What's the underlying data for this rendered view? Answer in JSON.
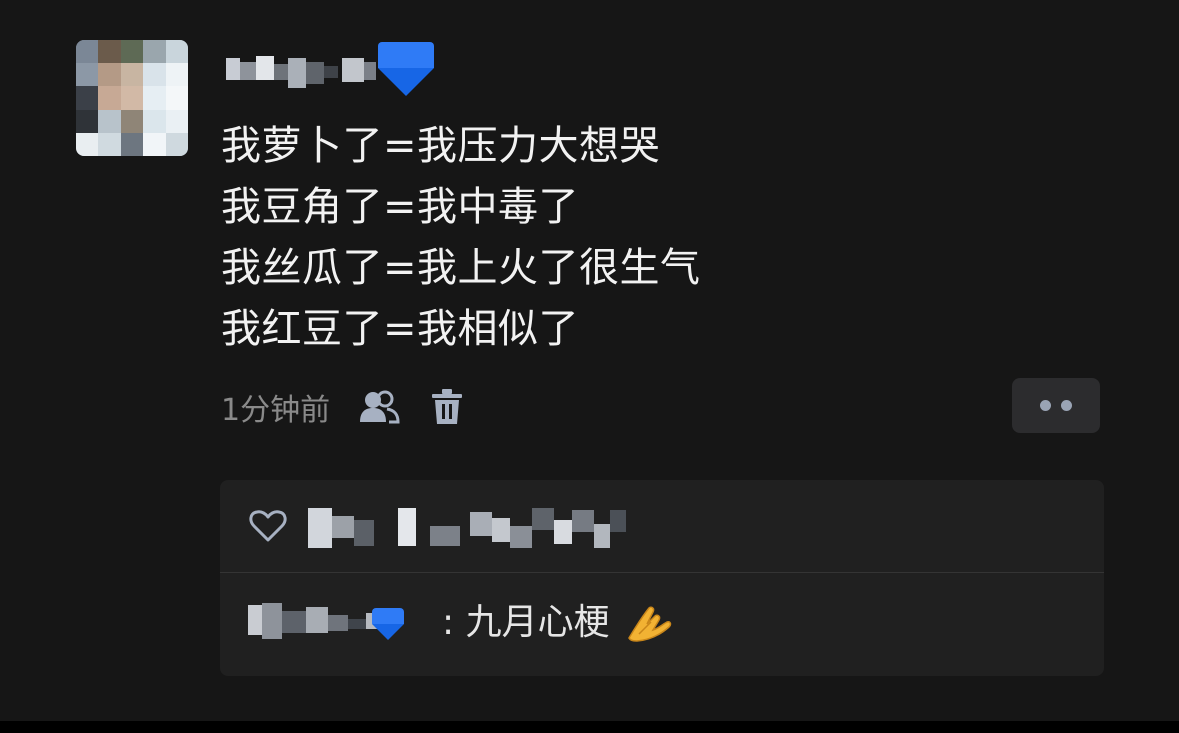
{
  "post": {
    "lines": [
      "我萝卜了=我压力大想哭",
      "我豆角了=我中毒了",
      "我丝瓜了=我上火了很生气",
      "我红豆了=我相似了"
    ],
    "timestamp": "1分钟前"
  },
  "icons": {
    "visibility": "friends-icon",
    "delete": "trash-icon",
    "more": "more-dots-icon",
    "like": "heart-outline-icon",
    "verified": "verified-diamond-badge",
    "comment_emoji": "praying-hands-emoji"
  },
  "comments": [
    {
      "separator": ":",
      "text": "九月心梗"
    }
  ],
  "colors": {
    "background": "#161616",
    "panel": "#202020",
    "text": "#f2f2f2",
    "muted": "#8a8a8a",
    "icon": "#a7b1c2",
    "accent": "#2f7bf6"
  }
}
